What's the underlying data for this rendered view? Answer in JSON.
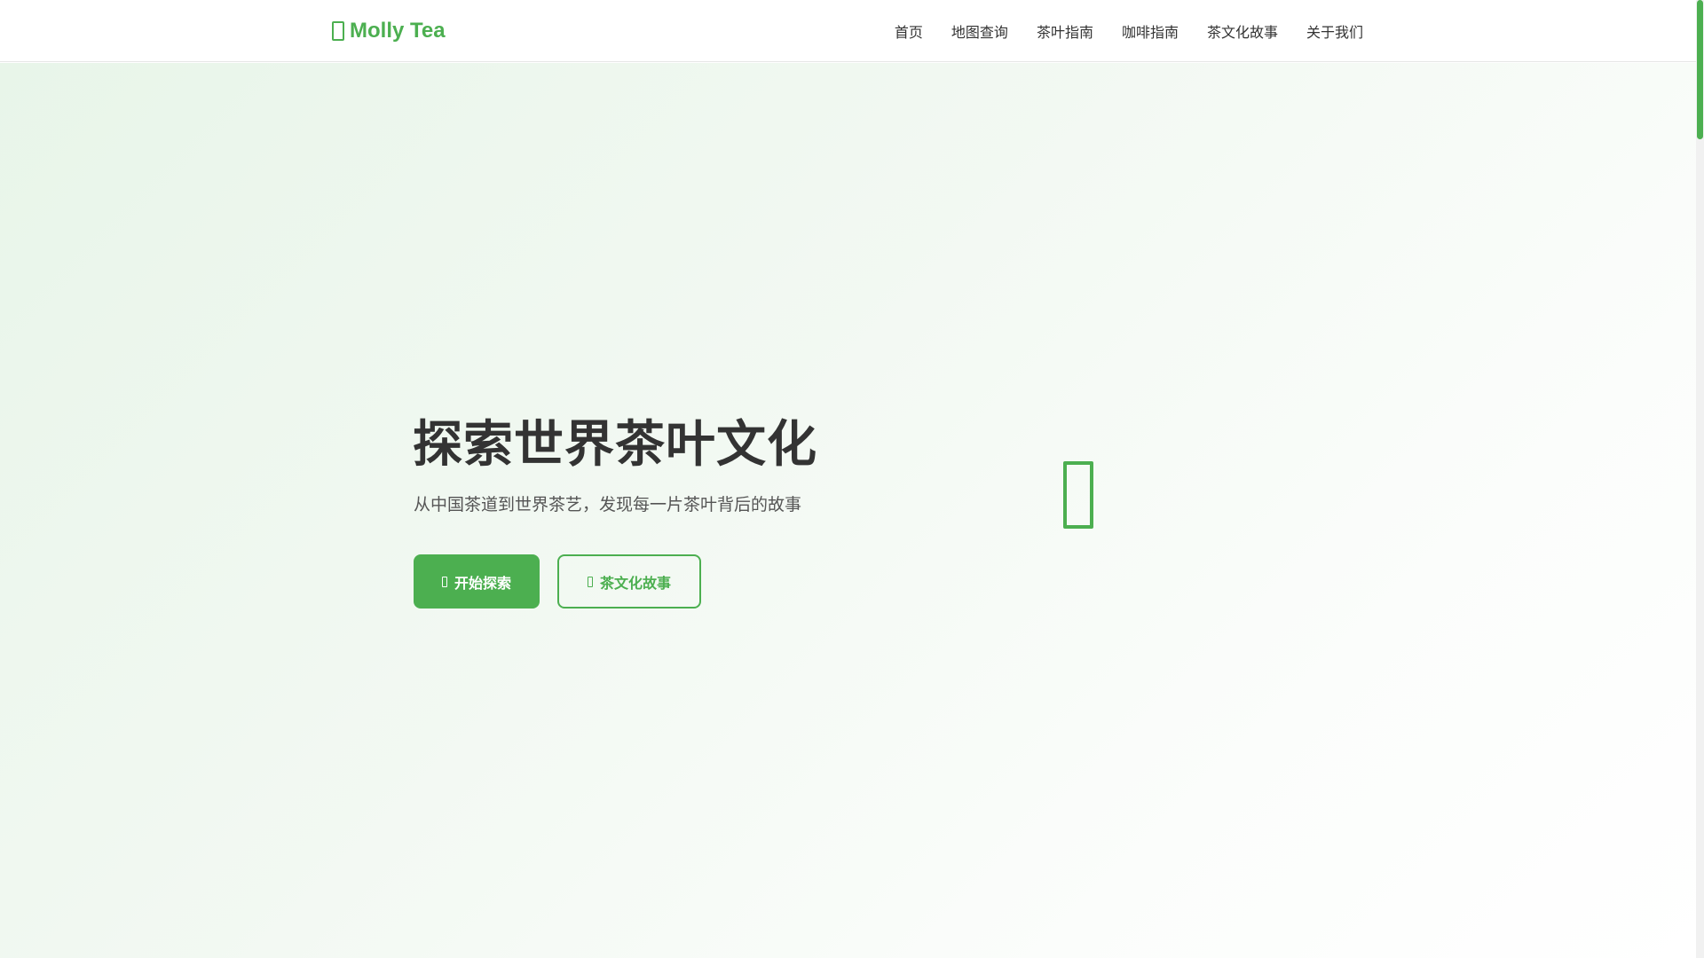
{
  "header": {
    "brand": "Molly Tea",
    "brand_icon": "leaf-icon",
    "nav": [
      {
        "label": "首页"
      },
      {
        "label": "地图查询"
      },
      {
        "label": "茶叶指南"
      },
      {
        "label": "咖啡指南"
      },
      {
        "label": "茶文化故事"
      },
      {
        "label": "关于我们"
      }
    ]
  },
  "hero": {
    "title": "探索世界茶叶文化",
    "subtitle": "从中国茶道到世界茶艺，发现每一片茶叶背后的故事",
    "primary_button": {
      "label": "开始探索",
      "icon": "compass-icon"
    },
    "secondary_button": {
      "label": "茶文化故事",
      "icon": "book-icon"
    },
    "graphic_icon": "tea-leaf-icon"
  },
  "colors": {
    "accent": "#4caf50",
    "text": "#333333",
    "subtext": "#555555",
    "hero_bg_start": "#e8f5e9",
    "hero_bg_end": "#ffffff"
  }
}
